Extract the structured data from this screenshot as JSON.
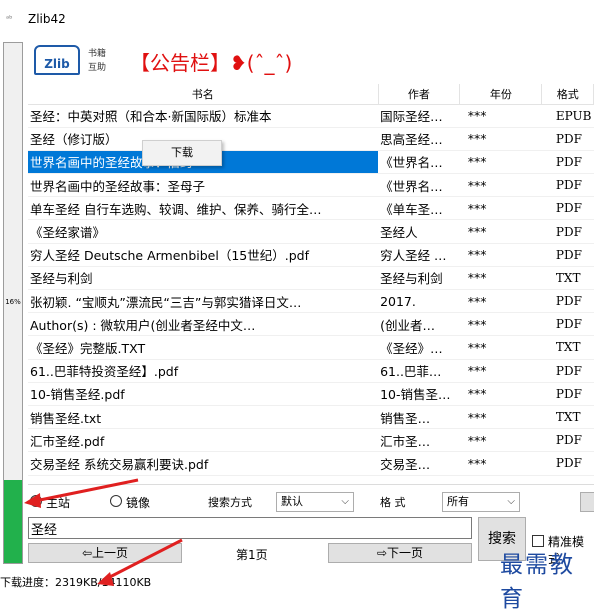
{
  "window": {
    "title": "Zlib42",
    "app_icon": "app-icon"
  },
  "progress": {
    "percent_label": "16%",
    "value": 0.16
  },
  "banner": {
    "logo_mark": "Zlib",
    "logo_line1": "书籍",
    "logo_line2": "互助",
    "notice": "【公告栏】❥(ˆ_ˆ)"
  },
  "table": {
    "headers": [
      "书名",
      "作者",
      "年份",
      "格式"
    ],
    "rows": [
      [
        "圣经：中英对照（和合本·新国际版）标准本",
        "国际圣经…",
        "***",
        "EPUB"
      ],
      [
        "圣经（修订版）",
        "思高圣经…",
        "***",
        "PDF"
      ],
      [
        "世界名画中的圣经故事：旧约",
        "《世界名…",
        "***",
        "PDF"
      ],
      [
        "世界名画中的圣经故事：圣母子",
        "《世界名…",
        "***",
        "PDF"
      ],
      [
        "单车圣经 自行车选购、较调、维护、保养、骑行全…",
        "《单车圣…",
        "***",
        "PDF"
      ],
      [
        "《圣经家谱》",
        "圣经人",
        "***",
        "PDF"
      ],
      [
        "穷人圣经 Deutsche Armenbibel（15世纪）.pdf",
        "穷人圣经 …",
        "***",
        "PDF"
      ],
      [
        "圣经与利剑",
        "圣经与利剑",
        "***",
        "TXT"
      ],
      [
        "张初颖. “宝顺丸”漂流民“三吉”与郭实猎译日文…",
        "2017.",
        "***",
        "PDF"
      ],
      [
        "Author(s)           : 微软用户(创业者圣经中文…",
        "(创业者…",
        "***",
        "PDF"
      ],
      [
        "《圣经》完整版.TXT",
        "《圣经》…",
        "***",
        "TXT"
      ],
      [
        "61..巴菲特投资圣经】.pdf",
        "61..巴菲…",
        "***",
        "PDF"
      ],
      [
        "10-销售圣经.pdf",
        "10-销售圣…",
        "***",
        "PDF"
      ],
      [
        "销售圣经.txt",
        "销售圣…",
        "***",
        "TXT"
      ],
      [
        "汇市圣经.pdf",
        "汇市圣…",
        "***",
        "PDF"
      ],
      [
        "交易圣经  系统交易赢利要诀.pdf",
        "交易圣…",
        "***",
        "PDF"
      ]
    ]
  },
  "context_menu": {
    "item": "下载"
  },
  "controls": {
    "radio_main": "主站",
    "radio_mirror": "镜像",
    "search_mode_label": "搜索方式",
    "search_mode_value": "默认",
    "format_label": "格 式",
    "format_value": "所有"
  },
  "search": {
    "value": "圣经",
    "button": "搜索",
    "exact_mode": "精准模式"
  },
  "pager": {
    "prev": "⇦上一页",
    "current": "第1页",
    "next": "⇨下一页"
  },
  "status": {
    "download_progress": "下载进度：2319KB/14110KB"
  },
  "watermark": "最需教育",
  "colors": {
    "progress_green": "#22b14c",
    "selection_blue": "#0078d7",
    "notice_red": "#e01010",
    "annotation_red": "#e02020"
  }
}
